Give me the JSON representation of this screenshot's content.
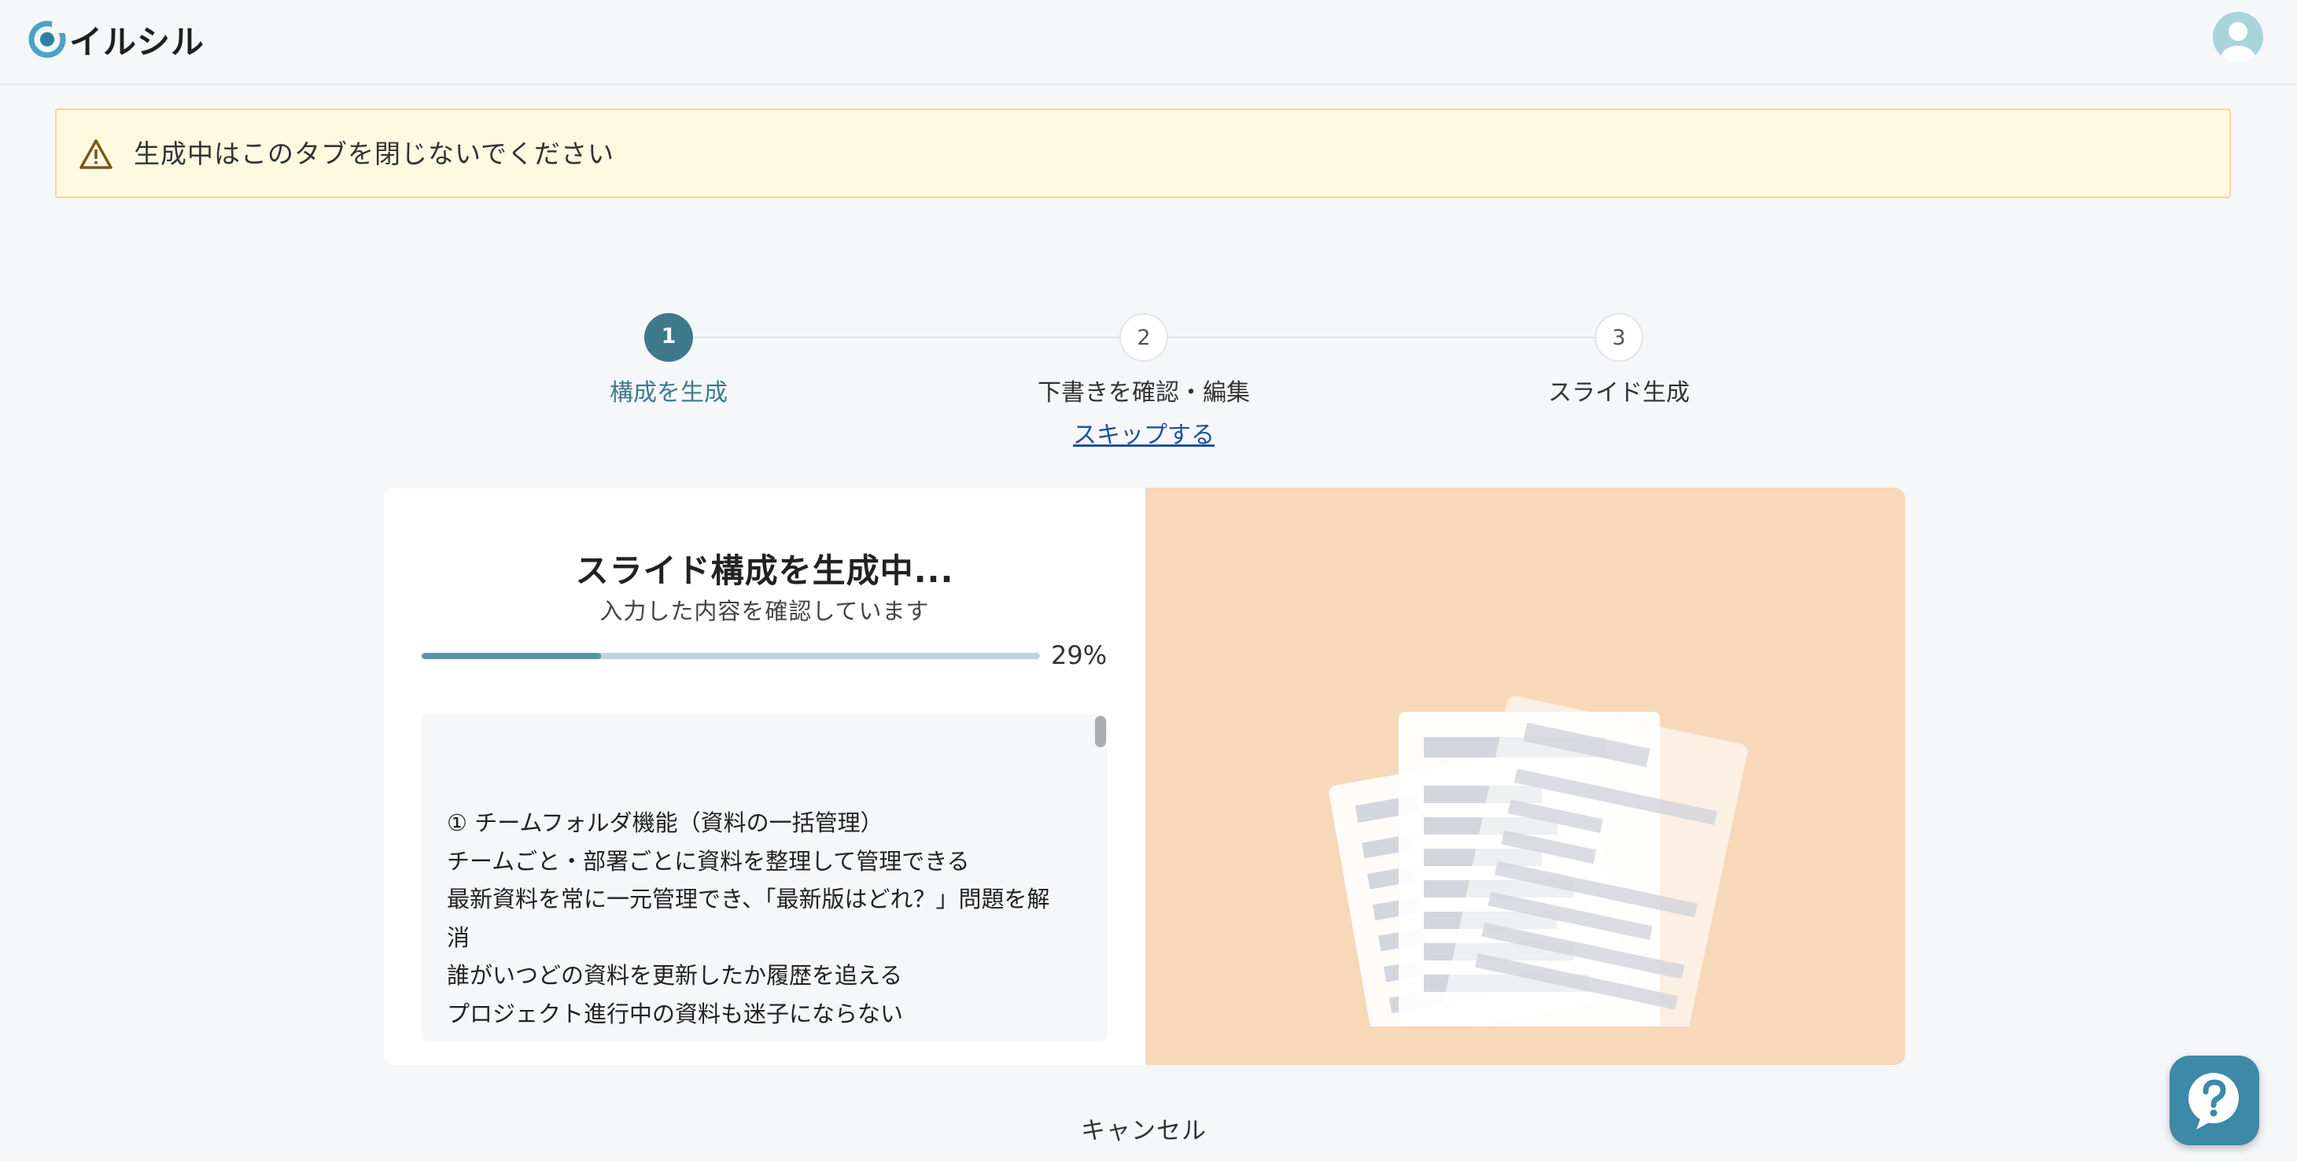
{
  "header": {
    "brand": "イルシル",
    "logo_icon": "illsill-logo-icon",
    "avatar_icon": "user-avatar-icon"
  },
  "warning": {
    "icon": "warning-triangle-icon",
    "text": "生成中はこのタブを閉じないでください",
    "background": "#fff9e0"
  },
  "stepper": {
    "steps": [
      {
        "number": "1",
        "label": "構成を生成",
        "active": true
      },
      {
        "number": "2",
        "label": "下書きを確認・編集",
        "active": false
      },
      {
        "number": "3",
        "label": "スライド生成",
        "active": false
      }
    ],
    "skip_label": "スキップする"
  },
  "generation": {
    "title": "スライド構成を生成中...",
    "subtitle": "入力した内容を確認しています",
    "progress_percent": 29,
    "progress_label": "29%",
    "log_lines": [
      "① チームフォルダ機能（資料の一括管理）",
      "チームごと・部署ごとに資料を整理して管理できる",
      "最新資料を常に一元管理でき、「最新版はどれ？」問題を解",
      "消",
      "誰がいつどの資料を更新したか履歴を追える",
      "プロジェクト進行中の資料も迷子にならない"
    ]
  },
  "illustration": {
    "icon": "documents-illustration-icon",
    "background": "#f7d8b9"
  },
  "cancel_label": "キャンセル",
  "help": {
    "icon": "help-question-icon"
  },
  "colors": {
    "accent": "#3d7b8c",
    "link": "#1f4fa3",
    "help_button": "#3d89a8"
  }
}
